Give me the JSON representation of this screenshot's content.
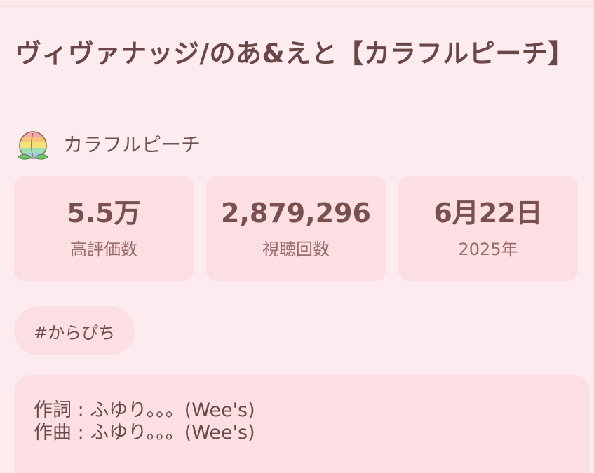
{
  "video": {
    "title": "ヴィヴァナッジ/のあ&えと【カラフルピーチ】",
    "channel_name": "カラフルピーチ"
  },
  "stats": [
    {
      "value": "5.5万",
      "label": "高評価数"
    },
    {
      "value": "2,879,296",
      "label": "視聴回数"
    },
    {
      "value": "6月22日",
      "label": "2025年"
    }
  ],
  "hashtags": [
    "#からぴち"
  ],
  "description": {
    "lines": [
      "作詞 : ふゆり。。。(Wee's)",
      "作曲 : ふゆり。。。(Wee's)"
    ]
  },
  "colors": {
    "background": "#fdecef",
    "card": "#fbdfe2",
    "text": "#6a4646"
  }
}
